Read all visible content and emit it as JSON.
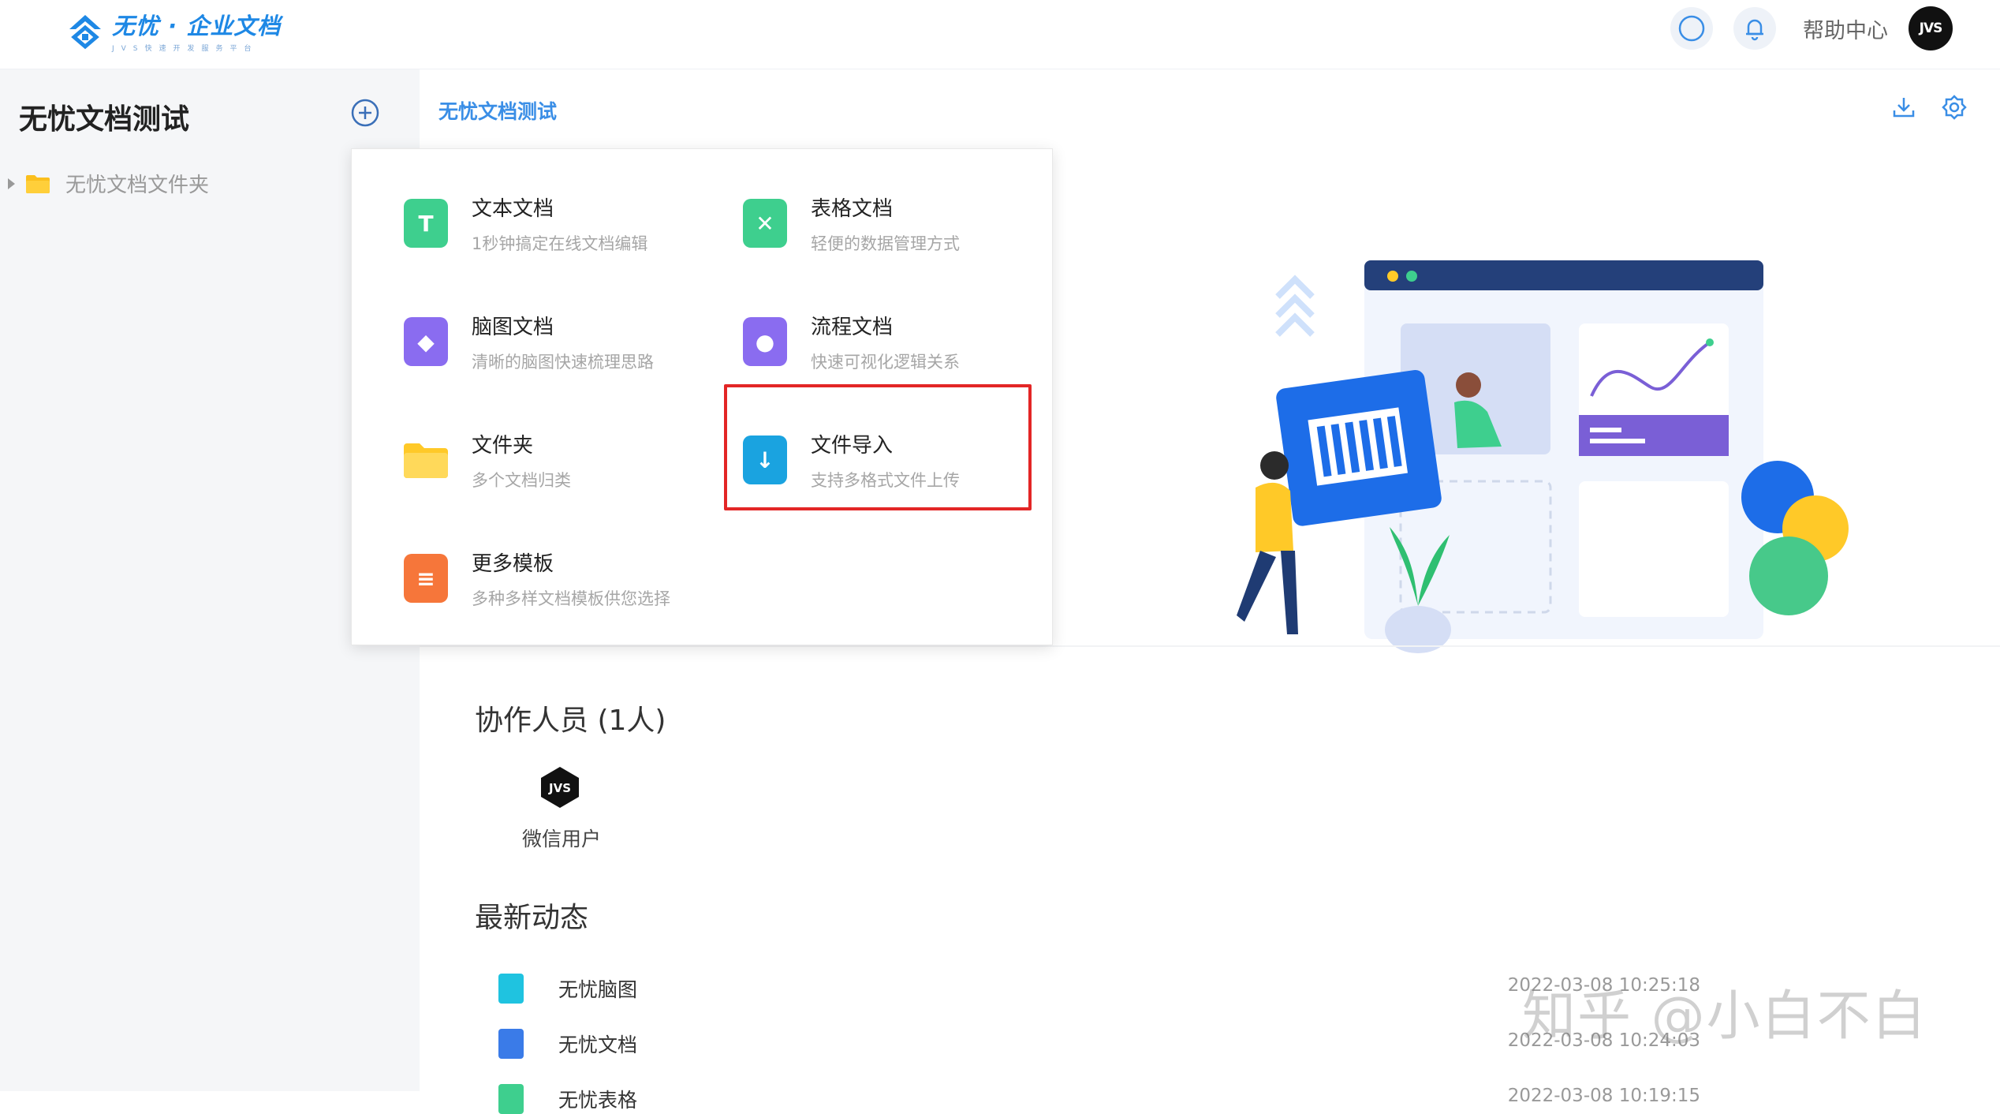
{
  "header": {
    "logo_title": "无忧 · 企业文档",
    "logo_subtitle": "JVS快速开发服务平台",
    "help_label": "帮助中心",
    "avatar_text": "JVS"
  },
  "sidebar": {
    "title": "无忧文档测试",
    "folder_label": "无忧文档文件夹"
  },
  "main": {
    "breadcrumb": "无忧文档测试"
  },
  "menu": {
    "items": [
      {
        "title": "文本文档",
        "subtitle": "1秒钟搞定在线文档编辑",
        "icon": "text-doc-icon",
        "glyph": "T",
        "color": "#3ecf8e"
      },
      {
        "title": "表格文档",
        "subtitle": "轻便的数据管理方式",
        "icon": "sheet-doc-icon",
        "glyph": "✕",
        "color": "#3ecf8e"
      },
      {
        "title": "脑图文档",
        "subtitle": "清晰的脑图快速梳理思路",
        "icon": "mindmap-doc-icon",
        "glyph": "◆",
        "color": "#8a6cf0"
      },
      {
        "title": "流程文档",
        "subtitle": "快速可视化逻辑关系",
        "icon": "flow-doc-icon",
        "glyph": "●",
        "color": "#8a6cf0"
      },
      {
        "title": "文件夹",
        "subtitle": "多个文档归类",
        "icon": "folder-icon",
        "glyph": "",
        "color": "#ffd44f"
      },
      {
        "title": "文件导入",
        "subtitle": "支持多格式文件上传",
        "icon": "file-import-icon",
        "glyph": "↓",
        "color": "#1aa3e0"
      },
      {
        "title": "更多模板",
        "subtitle": "多种多样文档模板供您选择",
        "icon": "template-icon",
        "glyph": "≡",
        "color": "#f6763a"
      }
    ]
  },
  "collaborators": {
    "title": "协作人员 (1人)",
    "users": [
      {
        "name": "微信用户",
        "avatar_text": "JVS"
      }
    ]
  },
  "activities": {
    "title": "最新动态",
    "items": [
      {
        "name": "无忧脑图",
        "time": "2022-03-08 10:25:18",
        "color": "#1fc3e0"
      },
      {
        "name": "无忧文档",
        "time": "2022-03-08 10:24:03",
        "color": "#3a7be8"
      },
      {
        "name": "无忧表格",
        "time": "2022-03-08 10:19:15",
        "color": "#3ecf8e"
      }
    ]
  },
  "watermark": "知乎 @小白不白",
  "colors": {
    "accent": "#3a8ee6",
    "highlight_border": "#e32626",
    "sidebar_bg": "#f5f6f8"
  }
}
